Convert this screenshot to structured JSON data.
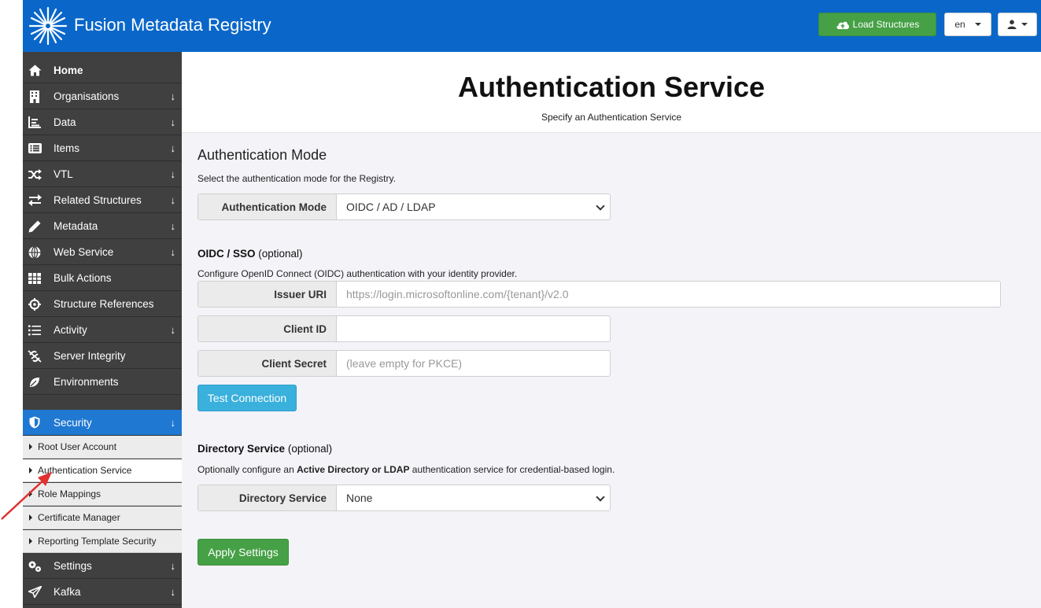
{
  "header": {
    "app_title": "Fusion Metadata Registry",
    "load_structures": "Load Structures",
    "language": "en",
    "brand_color": "#0a67c9"
  },
  "sidebar": {
    "items": [
      {
        "label": "Home",
        "icon": "home-icon",
        "has_arrow": false
      },
      {
        "label": "Organisations",
        "icon": "building-icon",
        "has_arrow": true
      },
      {
        "label": "Data",
        "icon": "chart-icon",
        "has_arrow": true
      },
      {
        "label": "Items",
        "icon": "list-box-icon",
        "has_arrow": true
      },
      {
        "label": "VTL",
        "icon": "shuffle-icon",
        "has_arrow": true
      },
      {
        "label": "Related Structures",
        "icon": "exchange-icon",
        "has_arrow": true
      },
      {
        "label": "Metadata",
        "icon": "pencil-icon",
        "has_arrow": true
      },
      {
        "label": "Web Service",
        "icon": "globe-icon",
        "has_arrow": true
      },
      {
        "label": "Bulk Actions",
        "icon": "table-icon",
        "has_arrow": false
      },
      {
        "label": "Structure References",
        "icon": "crosshair-icon",
        "has_arrow": false
      },
      {
        "label": "Activity",
        "icon": "list-icon",
        "has_arrow": true
      },
      {
        "label": "Server Integrity",
        "icon": "broken-link-icon",
        "has_arrow": false
      },
      {
        "label": "Environments",
        "icon": "leaf-icon",
        "has_arrow": false
      }
    ],
    "security": {
      "label": "Security",
      "icon": "shield-icon"
    },
    "security_sub": [
      "Root User Account",
      "Authentication Service",
      "Role Mappings",
      "Certificate Manager",
      "Reporting Template Security"
    ],
    "bottom_items": [
      {
        "label": "Settings",
        "icon": "gears-icon"
      },
      {
        "label": "Kafka",
        "icon": "paper-plane-icon"
      }
    ],
    "arrow_glyph": "↓"
  },
  "page": {
    "title": "Authentication Service",
    "subtitle": "Specify an Authentication Service"
  },
  "auth_mode": {
    "heading": "Authentication Mode",
    "description": "Select the authentication mode for the Registry.",
    "label": "Authentication Mode",
    "value": "OIDC / AD / LDAP"
  },
  "oidc": {
    "heading_bold": "OIDC / SSO",
    "heading_rest": " (optional)",
    "description": "Configure OpenID Connect (OIDC) authentication with your identity provider.",
    "issuer_label": "Issuer URI",
    "issuer_placeholder": "https://login.microsoftonline.com/{tenant}/v2.0",
    "client_id_label": "Client ID",
    "client_id_value": "",
    "client_secret_label": "Client Secret",
    "client_secret_placeholder": "(leave empty for PKCE)",
    "test_button": "Test Connection"
  },
  "directory": {
    "heading_bold": "Directory Service",
    "heading_rest": " (optional)",
    "desc_pre": "Optionally configure an ",
    "desc_bold": "Active Directory or LDAP",
    "desc_post": " authentication service for credential-based login.",
    "label": "Directory Service",
    "value": "None"
  },
  "apply_button": "Apply Settings"
}
